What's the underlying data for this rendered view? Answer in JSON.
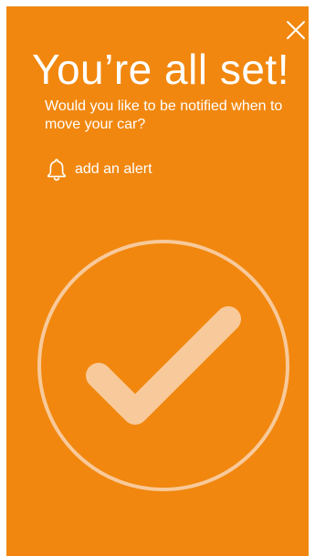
{
  "colors": {
    "background": "#F1870E",
    "check_fill": "#F8C99A",
    "circle_stroke": "#F8C99A",
    "text": "#FFFFFF"
  },
  "close": {
    "icon": "close-icon"
  },
  "header": {
    "title": "You’re all set!",
    "subtitle": "Would you like to be notified when to move your car?"
  },
  "alert": {
    "icon": "bell-icon",
    "label": "add an alert"
  },
  "confirmation": {
    "icon": "checkmark-icon"
  }
}
